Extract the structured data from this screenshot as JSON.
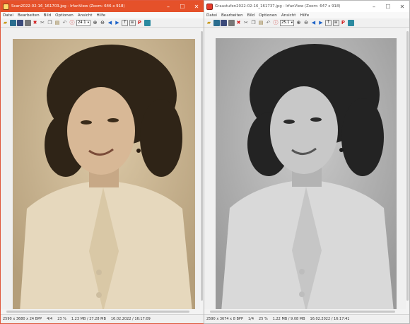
{
  "windows": [
    {
      "title": "Scan2022-02-16_161703.jpg - IrfanView (Zoom: 646 x 918)",
      "menu": [
        "Datei",
        "Bearbeiten",
        "Bild",
        "Optionen",
        "Ansicht",
        "Hilfe"
      ],
      "zoom": "24.1",
      "status": [
        "2590 x 3680 x 24 BPP",
        "4/4",
        "23 %",
        "1.23 MB / 27.28 MB",
        "16.02.2022 / 16:17:09"
      ]
    },
    {
      "title": "Graustufen2022-02-16_161737.jpg - IrfanView (Zoom: 647 x 918)",
      "menu": [
        "Datei",
        "Bearbeiten",
        "Bild",
        "Optionen",
        "Ansicht",
        "Hilfe"
      ],
      "zoom": "25.1",
      "status": [
        "2590 x 3674 x 8 BPP",
        "1/4",
        "25 %",
        "1.22 MB / 9.08 MB",
        "16.02.2022 / 16:17:41"
      ]
    }
  ],
  "window_controls": {
    "minimize": "–",
    "maximize": "☐",
    "close": "✕"
  },
  "toolbar_icons": [
    "open-folder-icon",
    "thumbnails-icon",
    "save-icon",
    "print-icon",
    "delete-icon",
    "cut-icon",
    "copy-icon",
    "paste-icon",
    "undo-icon",
    "info-icon",
    "zoom-in-icon",
    "zoom-out-icon",
    "prev-icon",
    "next-icon",
    "upload-icon",
    "settings-icon",
    "paint-icon",
    "slideshow-icon"
  ],
  "colors": {
    "active_titlebar": "#e5512a",
    "sepia_photo": "#cbb796",
    "gray_photo": "#b2b2b2"
  }
}
